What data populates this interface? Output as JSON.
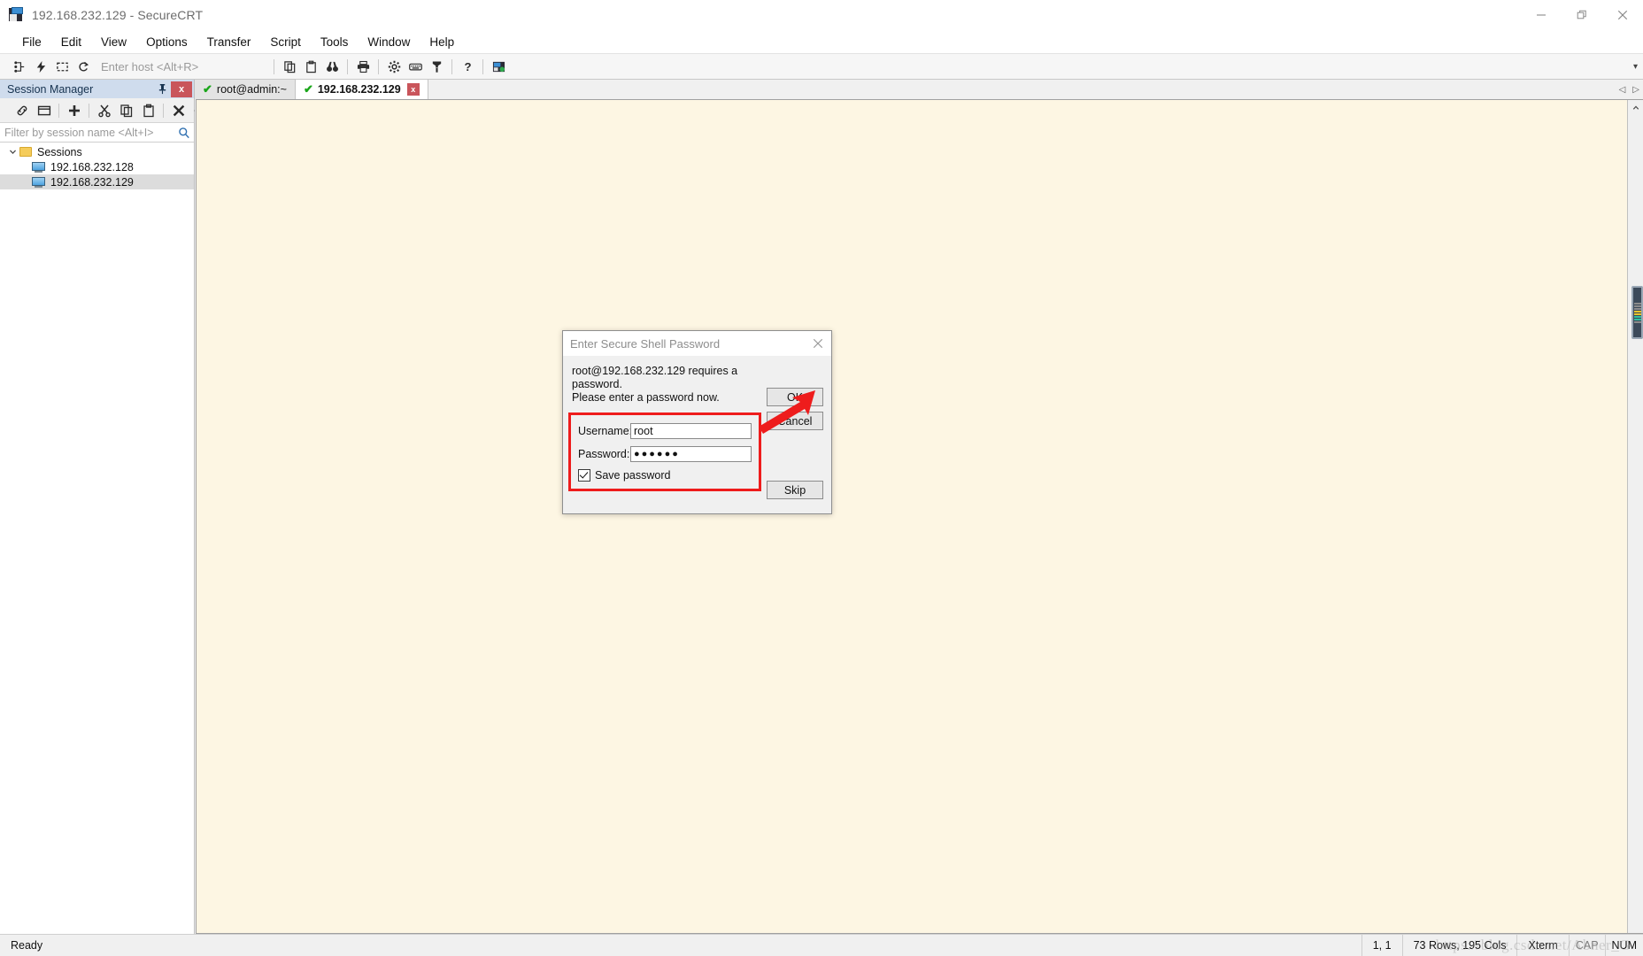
{
  "window": {
    "title": "192.168.232.129 - SecureCRT",
    "app_icon": "securecrt-terminal-icon",
    "controls": {
      "minimize": "minimize-icon",
      "restore": "restore-icon",
      "close": "close-icon"
    }
  },
  "menubar": {
    "items": [
      "File",
      "Edit",
      "View",
      "Options",
      "Transfer",
      "Script",
      "Tools",
      "Window",
      "Help"
    ]
  },
  "toolbar": {
    "host_placeholder": "Enter host <Alt+R>",
    "icons": [
      "connect-icon",
      "quick-connect-icon",
      "connect-in-tab-icon",
      "reconnect-icon"
    ],
    "icons2": [
      "copy-icon",
      "paste-icon",
      "find-icon"
    ],
    "icons3": [
      "print-icon"
    ],
    "icons4": [
      "session-options-icon",
      "keymap-editor-icon",
      "key-icon"
    ],
    "icons5": [
      "help-icon"
    ],
    "icons6": [
      "session-manager-toggle-icon"
    ],
    "overflow": "chevron-down-icon"
  },
  "session_manager": {
    "title": "Session Manager",
    "pin_icon": "pin-icon",
    "close_label": "x",
    "toolbar_icons": [
      "link-icon",
      "window-icon",
      "new-session-icon",
      "cut-icon",
      "copy-icon",
      "paste-icon",
      "delete-icon",
      "properties-gear-icon"
    ],
    "overflow": "»",
    "filter_placeholder": "Filter by session name <Alt+I>",
    "search_icon": "search-icon",
    "tree": {
      "root_label": "Sessions",
      "expand_icon": "chevron-down-icon",
      "folder_icon": "folder-icon",
      "children": [
        {
          "label": "192.168.232.128",
          "icon": "computer-icon",
          "selected": false
        },
        {
          "label": "192.168.232.129",
          "icon": "computer-icon",
          "selected": true
        }
      ]
    }
  },
  "tabs": [
    {
      "label": "root@admin:~",
      "status_icon": "green-check-icon",
      "active": false,
      "closable": false
    },
    {
      "label": "192.168.232.129",
      "status_icon": "green-check-icon",
      "active": true,
      "closable": true,
      "close_label": "x"
    }
  ],
  "tab_nav": {
    "prev": "◁",
    "next": "▷"
  },
  "terminal": {
    "background_color": "#fdf6e3"
  },
  "scrollbar": {
    "up_arrow": "˄",
    "down_arrow": "˅"
  },
  "dialog": {
    "title": "Enter Secure Shell Password",
    "close_icon": "close-icon",
    "message_line1": "root@192.168.232.129 requires a password.",
    "message_line2": "Please enter a password now.",
    "username_label": "Username:",
    "username_value": "root",
    "password_label": "Password:",
    "password_value": "●●●●●●",
    "save_password_label": "Save password",
    "save_password_checked": true,
    "buttons": {
      "ok": "OK",
      "cancel": "Cancel",
      "skip": "Skip"
    },
    "highlight_color": "#ee1c1c",
    "annotation": {
      "type": "red-arrow",
      "points_to": "ok-button",
      "color": "#ee1c1c"
    }
  },
  "statusbar": {
    "ready": "Ready",
    "cursor_position": "1,  1",
    "dimensions": "73 Rows, 195 Cols",
    "emulation": "Xterm",
    "caps": "CAP",
    "num": "NUM"
  },
  "watermark": {
    "text": "https://blog.csdn.net/Abner_G"
  }
}
